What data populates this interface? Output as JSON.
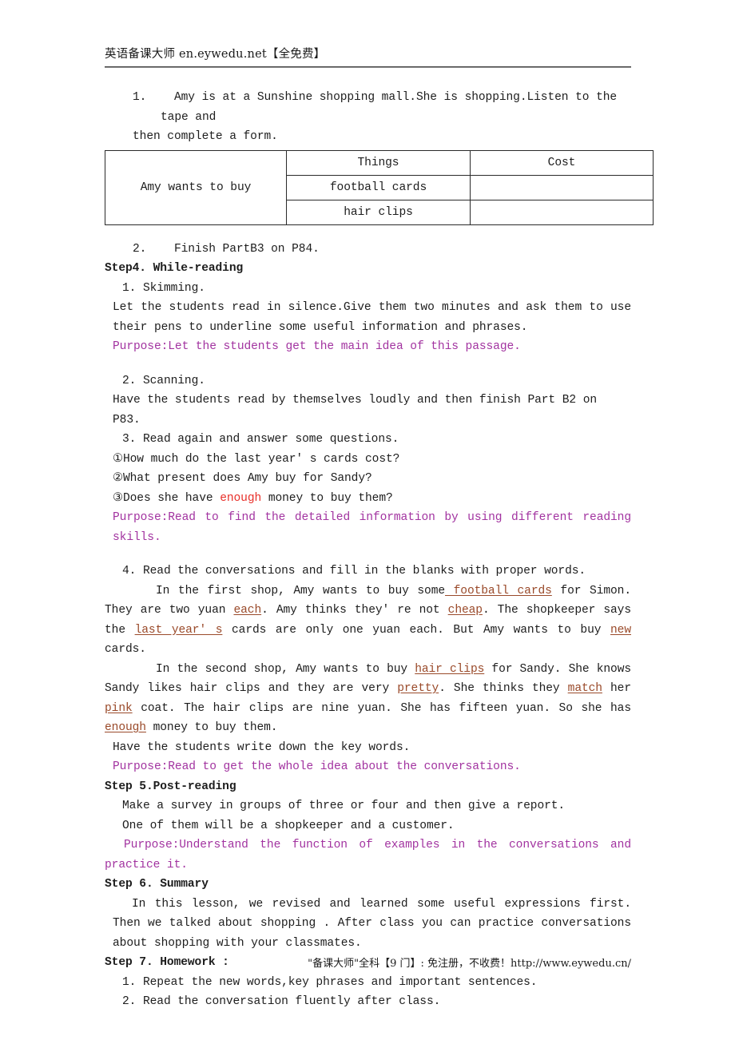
{
  "header": {
    "text": "英语备课大师 en.eywedu.net【全免费】"
  },
  "footer": {
    "text": "\"备课大师\"全科【9 门】: 免注册，不收费！http://www.eywedu.cn/"
  },
  "content": {
    "item1_line1": "1.    Amy is at a Sunshine shopping mall.She is shopping.Listen to the tape and",
    "item1_line2": "then complete a form.",
    "item2": "2.    Finish PartB3 on P84.",
    "step4_heading": "Step4. While-reading",
    "skimming_num": "1. Skimming.",
    "skimming_body": "Let the students read in silence.Give them two minutes and ask them to use their pens to underline some useful information and phrases.",
    "purpose1": "Purpose:Let the students get the main idea of this passage.",
    "scanning_num": "2. Scanning.",
    "scanning_body": "Have the students read by themselves loudly and then finish Part B2 on P83.",
    "q_intro": "3. Read again and answer some questions.",
    "q1": "①How much do the last year' s cards cost?",
    "q2": "②What present does Amy buy for Sandy?",
    "q3_a": "③Does she have ",
    "q3_hl": "enough",
    "q3_b": " money to buy them?",
    "purpose2": "Purpose:Read to find the detailed information by using different reading skills.",
    "item4": "4. Read the conversations and fill in the blanks with proper words.",
    "para1": {
      "t1": "In the first shop, Amy wants to buy some",
      "b1": " football cards",
      "t2": " for Simon. They are two yuan ",
      "b2": "each",
      "t3": ". Amy thinks they' re not ",
      "b3": "cheap",
      "t4": ". The shopkeeper says the ",
      "b4": "last year' s",
      "t5": " cards are only one yuan each. But Amy wants to buy ",
      "b5": "new",
      "t6": " cards."
    },
    "para2": {
      "t1": "In the second shop, Amy wants to buy ",
      "b1": "hair clips",
      "t2": " for Sandy. She knows Sandy likes hair clips and they are very ",
      "b2": "pretty",
      "t3": ". She thinks they ",
      "b3": "match",
      "t4": " her ",
      "b4": "pink",
      "t5": " coat. The hair clips are nine yuan. She has fifteen yuan. So she has ",
      "b5": "enough",
      "t6": " money to buy them."
    },
    "key_words_line": "Have the students write down the key words.",
    "purpose3": "Purpose:Read to get the whole idea about the conversations.",
    "step5_heading": "Step 5.Post-reading",
    "step5_l1": "Make a survey in groups of three or four and then give a report.",
    "step5_l2": "One of them will be a shopkeeper and a customer.",
    "purpose4": "Purpose:Understand the function of examples in the conversations and practice it.",
    "step6_heading": "Step 6. Summary",
    "step6_body": "In this lesson, we revised and learned some useful expressions first. Then we talked about shopping . After class you can practice conversations about shopping with your classmates.",
    "step7_heading": "Step 7. Homework :",
    "hw1": "1. Repeat the new words,key phrases and important sentences.",
    "hw2": "2. Read the conversation fluently after class."
  },
  "table": {
    "row_label": "Amy wants to buy",
    "col_things": "Things",
    "col_cost": "Cost",
    "row1_thing": "football cards",
    "row1_cost": "",
    "row2_thing": "hair clips",
    "row2_cost": ""
  },
  "colors": {
    "purpose": "#a233a0",
    "highlight_red": "#e8302a",
    "blank_fill": "#9a4a2a",
    "text": "#1d1d1d"
  }
}
